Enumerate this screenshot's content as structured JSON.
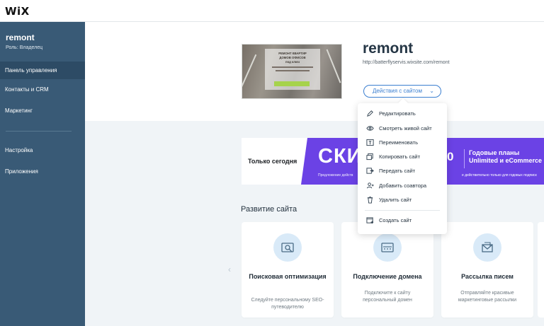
{
  "app": {
    "logo": "WiX"
  },
  "sidebar": {
    "site_name": "remont",
    "role": "Роль: Владелец",
    "items": [
      {
        "label": "Панель управления"
      },
      {
        "label": "Контакты и CRM"
      },
      {
        "label": "Маркетинг"
      },
      {
        "label": "Настройка"
      },
      {
        "label": "Приложения"
      }
    ]
  },
  "site": {
    "title": "remont",
    "url": "http://batterflyservis.wixsite.com/remont",
    "actions_button": "Действия с сайтом",
    "preview_lines": [
      "РЕМОНТ КВАРТИР",
      "ДОМОВ ОФИСОВ",
      "под ключ"
    ]
  },
  "actions_menu": {
    "items": [
      {
        "label": "Редактировать",
        "icon": "pencil-icon"
      },
      {
        "label": "Смотреть живой сайт",
        "icon": "eye-icon"
      },
      {
        "label": "Переименовать",
        "icon": "rename-icon"
      },
      {
        "label": "Копировать сайт",
        "icon": "copy-icon"
      },
      {
        "label": "Передать сайт",
        "icon": "transfer-icon"
      },
      {
        "label": "Добавить соавтора",
        "icon": "person-add-icon"
      },
      {
        "label": "Удалить сайт",
        "icon": "trash-icon"
      },
      {
        "label": "Создать сайт",
        "icon": "new-site-icon"
      }
    ]
  },
  "promo": {
    "left_label": "Только сегодня",
    "big_text": "СКИ",
    "digit": "0",
    "right_title": "Годовые планы",
    "right_subtitle": "Unlimited и eCommerce",
    "small_left": "Предложение действ",
    "small_right": "е действительно только для годовых подписк"
  },
  "development": {
    "title": "Развитие сайта",
    "cards": [
      {
        "title": "Поисковая оптимизация",
        "text": "Следуйте персональному SEO-путеводителю",
        "icon": "seo-icon"
      },
      {
        "title": "Подключение домена",
        "text": "Подключите к сайту персональный домен",
        "icon": "domain-icon"
      },
      {
        "title": "Рассылка писем",
        "text": "Отправляйте красивые маркетинговые рассылки",
        "icon": "mail-icon"
      }
    ]
  },
  "colors": {
    "sidebar": "#395a76",
    "accent": "#3b7fd0",
    "promo": "#6b42e5",
    "icon_bg": "#d9eaf8"
  }
}
